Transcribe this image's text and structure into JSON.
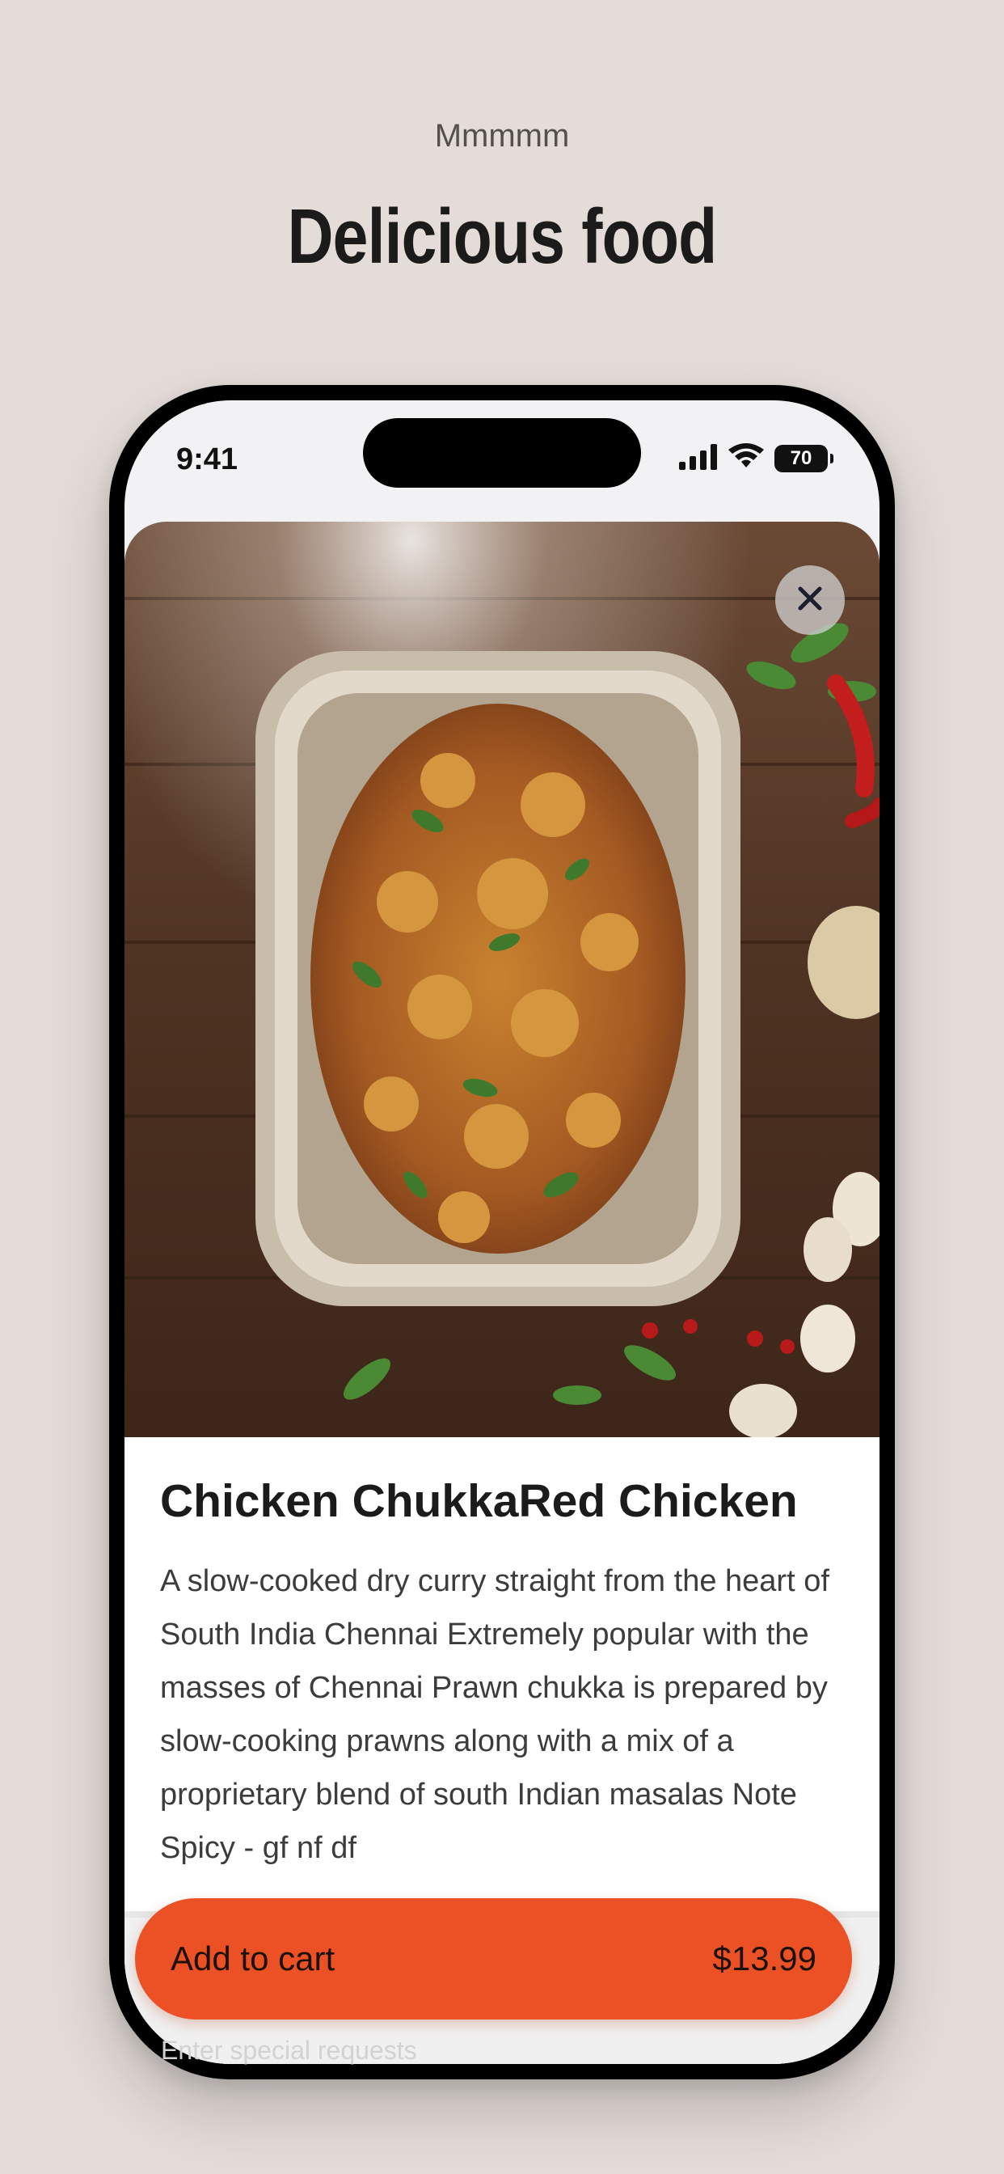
{
  "header": {
    "eyebrow": "Mmmmm",
    "headline": "Delicious food"
  },
  "status_bar": {
    "time": "9:41",
    "battery": "70"
  },
  "product": {
    "image": "chicken-chukka-photo",
    "title": "Chicken ChukkaRed Chicken",
    "description": "A slow-cooked dry curry straight from the heart of South India Chennai Extremely popular with the masses of Chennai Prawn chukka is prepared by slow-cooking prawns along with a mix of a proprietary blend of south Indian masalas Note Spicy - gf nf df"
  },
  "special_requests": {
    "placeholder": "Enter special requests"
  },
  "cart": {
    "label": "Add to cart",
    "price": "$13.99"
  },
  "colors": {
    "background": "#e4dcd9",
    "accent": "#eb5124",
    "text": "#1b1b1b"
  }
}
